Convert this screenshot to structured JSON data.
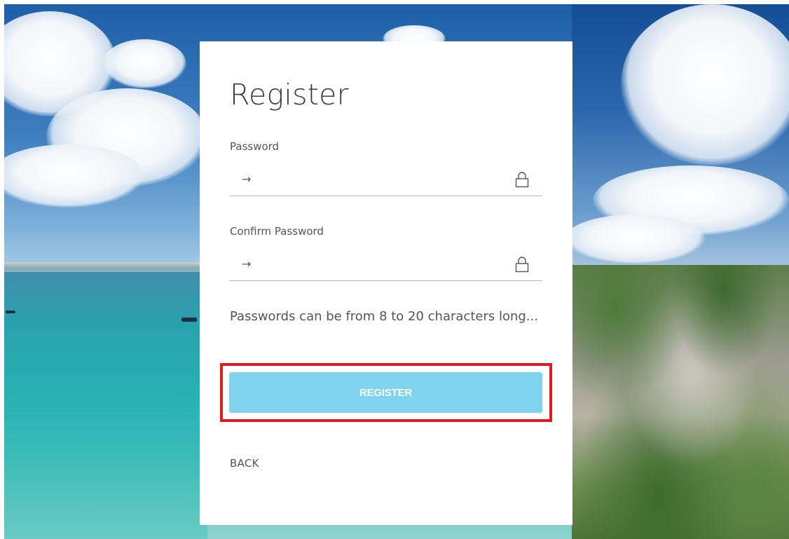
{
  "form": {
    "title": "Register",
    "password_label": "Password",
    "password_value": "",
    "confirm_label": "Confirm Password",
    "confirm_value": "",
    "hint": "Passwords can be from 8 to 20 characters long...",
    "register_label": "REGISTER",
    "back_label": "BACK"
  },
  "icons": {
    "field_prefix": "arrow-right-icon",
    "field_suffix": "lock-icon"
  },
  "colors": {
    "button": "#7fd3ee",
    "highlight": "#e01b1b",
    "card": "#ffffff"
  }
}
